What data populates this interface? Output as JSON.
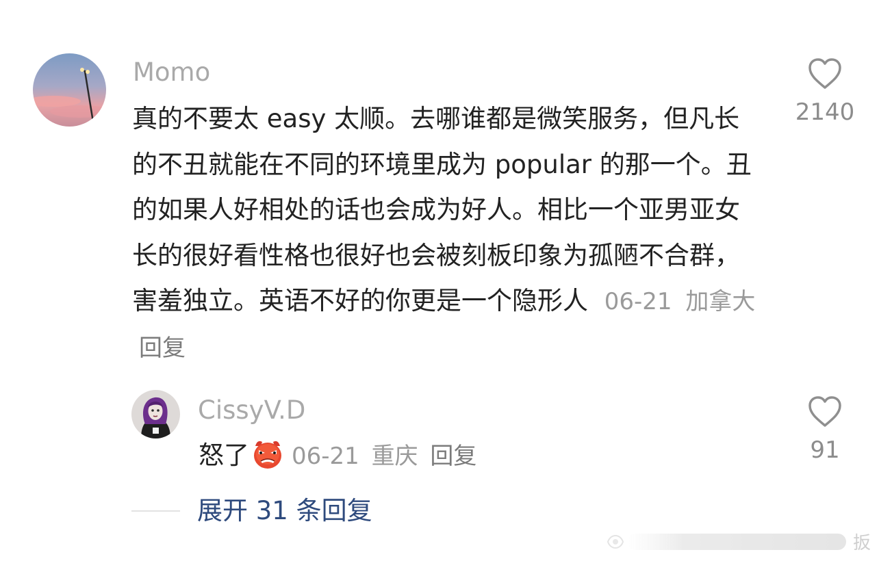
{
  "comment": {
    "username": "Momo",
    "text": "真的不要太 easy 太顺。去哪谁都是微笑服务，但凡长的不丑就能在不同的环境里成为 popular 的那一个。丑的如果人好相处的话也会成为好人。相比一个亚男亚女长的很好看性格也很好也会被刻板印象为孤陋不合群，害羞独立。英语不好的你更是一个隐形人",
    "date": "06-21",
    "location": "加拿大",
    "reply_label": "回复",
    "likes": "2140"
  },
  "reply": {
    "username": "CissyV.D",
    "text": "怒了",
    "emoji": "angry-face-emoji",
    "date": "06-21",
    "location": "重庆",
    "reply_label": "回复",
    "likes": "91"
  },
  "expand": {
    "label": "展开 31 条回复"
  },
  "watermark": {
    "text": "扳"
  }
}
